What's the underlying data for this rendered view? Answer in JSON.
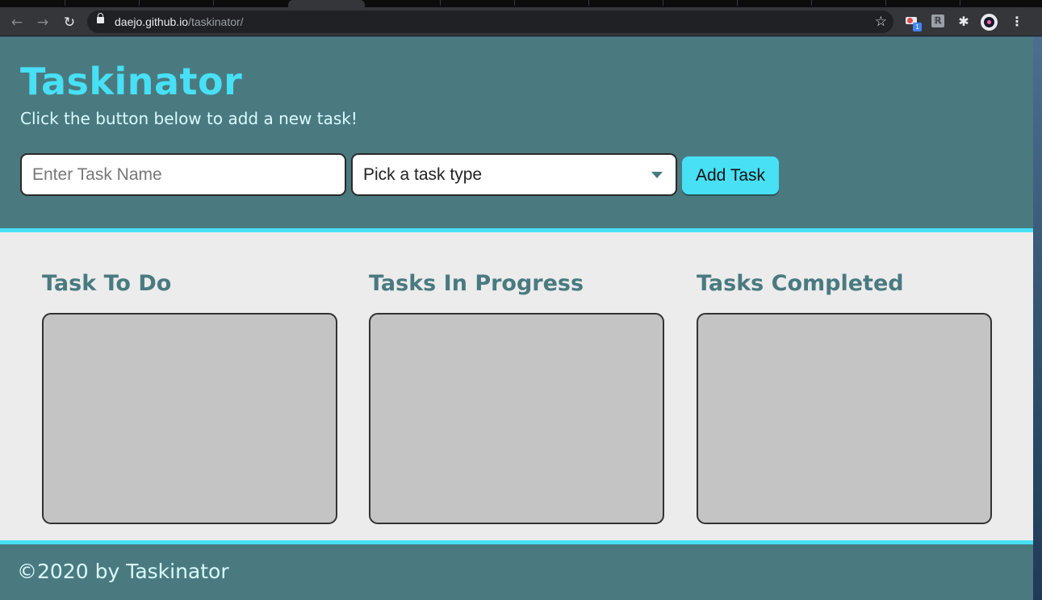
{
  "browser": {
    "url_host": "daejo.github.io",
    "url_path": "/taskinator/",
    "extension_badge": "1"
  },
  "app": {
    "title": "Taskinator",
    "subtitle": "Click the button below to add a new task!",
    "form": {
      "task_name_placeholder": "Enter Task Name",
      "task_name_value": "",
      "task_type_selected": "Pick a task type",
      "add_button_label": "Add Task"
    },
    "columns": [
      {
        "title": "Task To Do",
        "tasks": []
      },
      {
        "title": "Tasks In Progress",
        "tasks": []
      },
      {
        "title": "Tasks Completed",
        "tasks": []
      }
    ],
    "footer": "©2020 by Taskinator"
  },
  "colors": {
    "header_bg": "#4a7a80",
    "accent": "#47e0f5",
    "list_bg": "#c4c4c4",
    "page_bg": "#ececec"
  },
  "icons": {
    "back": "back-arrow-icon",
    "forward": "forward-arrow-icon",
    "reload": "reload-icon",
    "lock": "lock-icon",
    "bookmark": "star-icon",
    "extensions": "puzzle-icon",
    "menu": "kebab-menu-icon"
  }
}
